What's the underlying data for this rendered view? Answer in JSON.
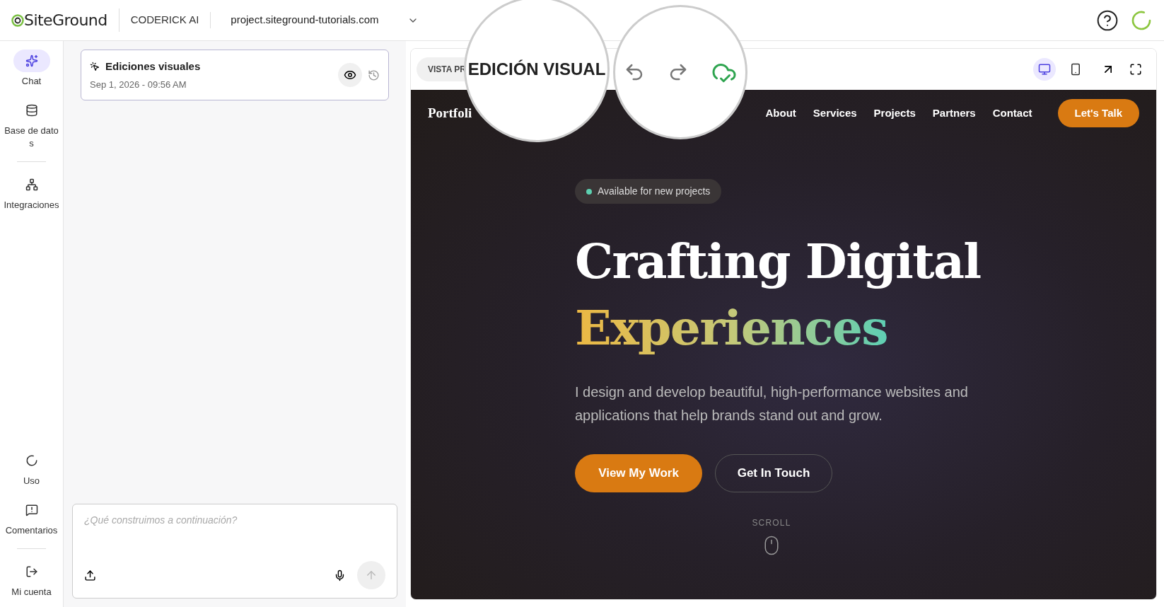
{
  "header": {
    "logo": "SiteGround",
    "product": "CODERICK AI",
    "project": "project.siteground-tutorials.com"
  },
  "sidebar": {
    "top": [
      {
        "label": "Chat",
        "kind": "chat",
        "selected": true
      },
      {
        "label": "Base de datos",
        "kind": "database",
        "selected": false
      },
      {
        "label": "Integraciones",
        "kind": "integrations",
        "selected": false
      }
    ],
    "bottom": [
      {
        "label": "Uso",
        "kind": "usage",
        "selected": false
      },
      {
        "label": "Comentarios",
        "kind": "feedback",
        "selected": false
      },
      {
        "label": "Mi cuenta",
        "kind": "account",
        "selected": false
      }
    ]
  },
  "session": {
    "title": "Ediciones visuales",
    "date": "Sep 1, 2026 - 09:56 AM"
  },
  "composer": {
    "placeholder": "¿Qué construimos a continuación?"
  },
  "preview": {
    "mode_label": "VISTA PR",
    "magnified_label": "EDICIÓN VISUAL",
    "devices": [
      {
        "kind": "desktop",
        "selected": true
      },
      {
        "kind": "mobile",
        "selected": false
      }
    ]
  },
  "site": {
    "brand": "Portfoli",
    "nav": [
      "About",
      "Services",
      "Projects",
      "Partners",
      "Contact"
    ],
    "cta": "Let's Talk",
    "badge": "Available for new projects",
    "headline": "Crafting Digital",
    "headline_accent": "Experiences",
    "lead": "I design and develop beautiful, high-performance websites and applications that help brands stand out and grow.",
    "primary": "View My Work",
    "secondary": "Get In Touch",
    "scroll": "SCROLL"
  }
}
